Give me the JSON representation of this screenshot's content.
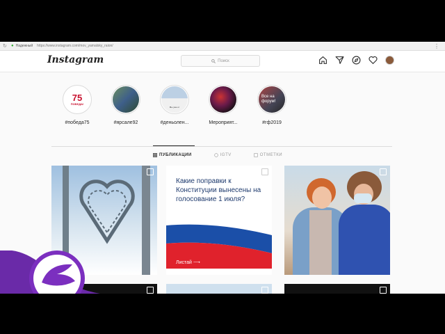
{
  "browser": {
    "secure_label": "Надежный",
    "url": "https://www.instagram.com/mov_yamalsky_raion/"
  },
  "header": {
    "logo": "Instagram",
    "search_placeholder": "Поиск"
  },
  "stories": [
    {
      "label": "#победа75",
      "badge_big": "75",
      "badge_text": "ПОБЕДА!"
    },
    {
      "label": "#ярсале92"
    },
    {
      "label": "#деньолен...",
      "caption": "Мы уже от"
    },
    {
      "label": "Мероприят..."
    },
    {
      "label": "#гф2019",
      "caption": "Все на форум!"
    }
  ],
  "tabs": [
    {
      "label": "ПУБЛИКАЦИИ",
      "active": true
    },
    {
      "label": "IGTV",
      "active": false
    },
    {
      "label": "ОТМЕТКИ",
      "active": false
    }
  ],
  "posts": {
    "amendments": {
      "title": "Какие поправки к Конституции вынесены на голосование 1 июля?",
      "cta": "Листай ⟶"
    }
  },
  "colors": {
    "flag_white": "#ffffff",
    "flag_blue": "#1b4fa8",
    "flag_red": "#e0222c",
    "watermark_purple": "#7b2fbf"
  }
}
